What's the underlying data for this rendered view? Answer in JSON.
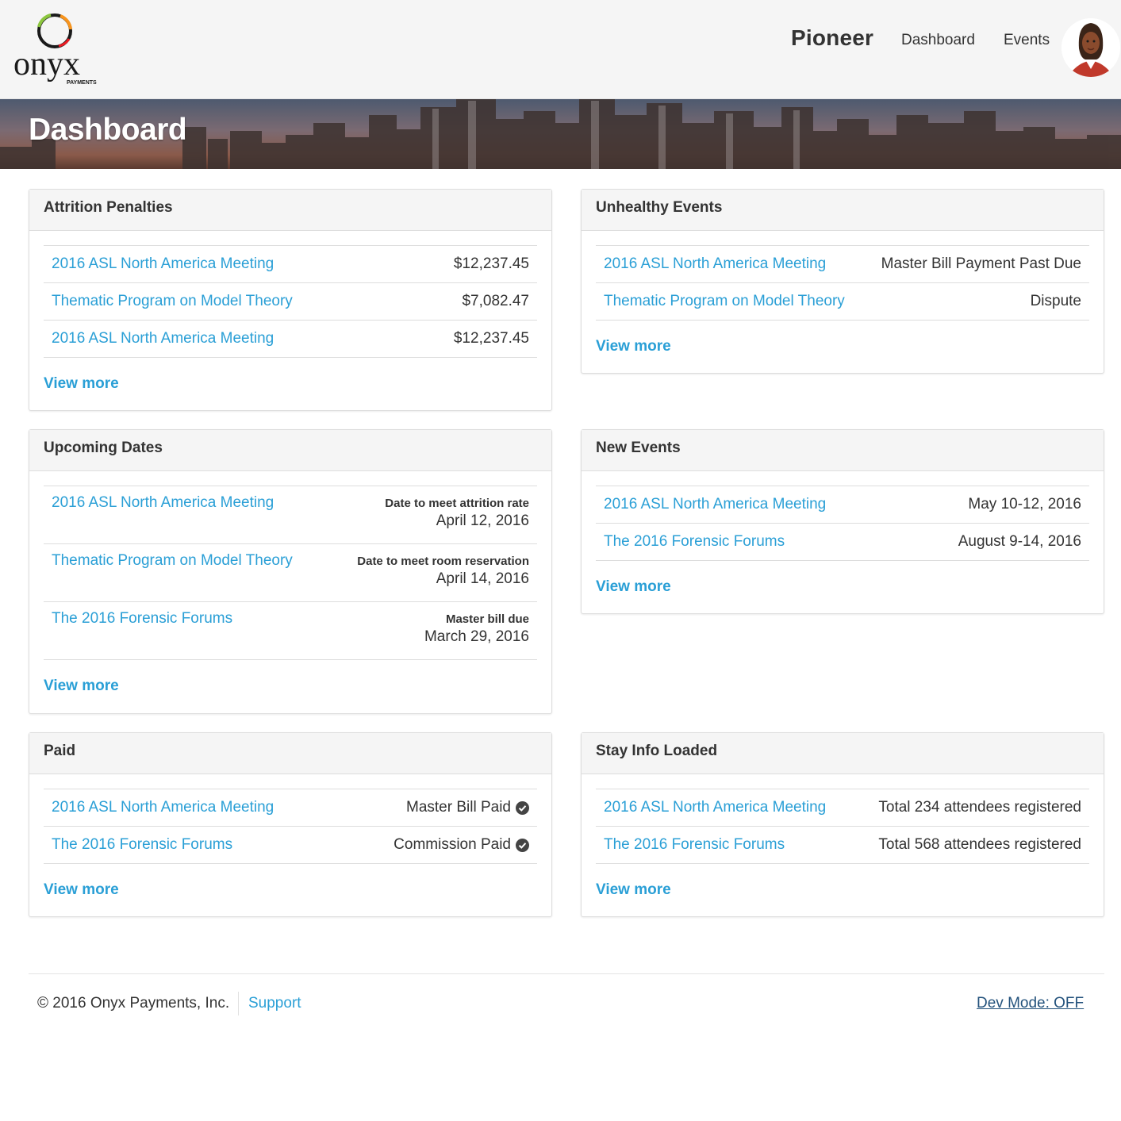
{
  "header": {
    "logo_text": "onyx",
    "logo_sub": "PAYMENTS",
    "brand": "Pioneer",
    "nav": {
      "dashboard": "Dashboard",
      "events": "Events"
    }
  },
  "banner": {
    "title": "Dashboard"
  },
  "panels": {
    "attrition": {
      "title": "Attrition Penalties",
      "rows": [
        {
          "event": "2016 ASL North America Meeting",
          "value": "$12,237.45"
        },
        {
          "event": "Thematic Program on Model Theory",
          "value": "$7,082.47"
        },
        {
          "event": "2016 ASL North America Meeting",
          "value": "$12,237.45"
        }
      ],
      "view_more": "View more"
    },
    "unhealthy": {
      "title": "Unhealthy Events",
      "rows": [
        {
          "event": "2016 ASL North America Meeting",
          "value": "Master Bill Payment Past Due"
        },
        {
          "event": "Thematic Program on Model Theory",
          "value": "Dispute"
        }
      ],
      "view_more": "View more"
    },
    "upcoming": {
      "title": "Upcoming Dates",
      "rows": [
        {
          "event": "2016 ASL North America Meeting",
          "label": "Date to meet attrition rate",
          "date": "April 12, 2016"
        },
        {
          "event": "Thematic Program on Model Theory",
          "label": "Date to meet room reservation",
          "date": "April 14, 2016"
        },
        {
          "event": "The 2016 Forensic Forums",
          "label": "Master bill due",
          "date": "March 29, 2016"
        }
      ],
      "view_more": "View more"
    },
    "new_events": {
      "title": "New Events",
      "rows": [
        {
          "event": "2016 ASL North America Meeting",
          "value": "May 10-12, 2016"
        },
        {
          "event": "The 2016 Forensic Forums",
          "value": "August 9-14, 2016"
        }
      ],
      "view_more": "View more"
    },
    "paid": {
      "title": "Paid",
      "rows": [
        {
          "event": "2016 ASL North America Meeting",
          "value": "Master Bill Paid",
          "icon": "check-circle-icon"
        },
        {
          "event": "The 2016 Forensic Forums",
          "value": "Commission Paid",
          "icon": "check-circle-icon"
        }
      ],
      "view_more": "View more"
    },
    "stay_info": {
      "title": "Stay Info Loaded",
      "rows": [
        {
          "event": "2016 ASL North America Meeting",
          "value": "Total 234 attendees registered"
        },
        {
          "event": "The 2016 Forensic Forums",
          "value": "Total 568 attendees registered"
        }
      ],
      "view_more": "View more"
    }
  },
  "footer": {
    "copyright": "© 2016 Onyx Payments, Inc.",
    "support": "Support",
    "dev_mode": "Dev Mode: OFF"
  },
  "colors": {
    "link": "#2a9fd6",
    "header_bg": "#f5f5f5",
    "text": "#333333"
  }
}
